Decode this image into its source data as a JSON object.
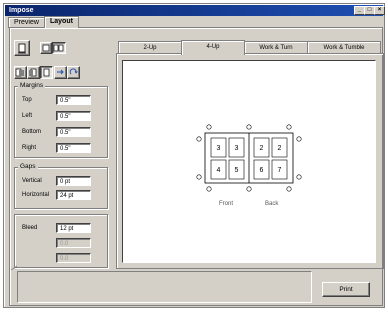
{
  "window": {
    "title": "Impose"
  },
  "title_buttons": [
    "_",
    "□",
    "×"
  ],
  "panel_tabs": [
    "Preview",
    "Layout"
  ],
  "icons": [
    "page-icon",
    "single-page-icon",
    "two-page-icon",
    "copy-left-icon",
    "copy-right-icon",
    "copy-center-icon",
    "flip-icon",
    "rotate-icon"
  ],
  "margins": {
    "group_label": "Margins",
    "fields": [
      {
        "label": "Top",
        "value": "0.5\""
      },
      {
        "label": "Left",
        "value": "0.5\""
      },
      {
        "label": "Bottom",
        "value": "0.5\""
      },
      {
        "label": "Right",
        "value": "0.5\""
      }
    ]
  },
  "gaps": {
    "group_label": "Gaps",
    "fields": [
      {
        "label": "Vertical",
        "value": "0 pt"
      },
      {
        "label": "Horizontal",
        "value": "24 pt"
      }
    ]
  },
  "bleed": {
    "label": "Bleed",
    "value": "12 pt",
    "disabled_fields": [
      {
        "label": "",
        "value": "0.0"
      },
      {
        "label": "",
        "value": "0.0"
      }
    ]
  },
  "layout_tabs": [
    "2-Up",
    "4-Up",
    "Work & Turn",
    "Work & Tumble"
  ],
  "selected_layout_tab": "4-Up",
  "sheet": {
    "front_pages": [
      "3",
      "3",
      "4",
      "5"
    ],
    "back_pages": [
      "2",
      "2",
      "6",
      "7"
    ],
    "front_label": "Front",
    "back_label": "Back"
  },
  "print_button": "Print"
}
